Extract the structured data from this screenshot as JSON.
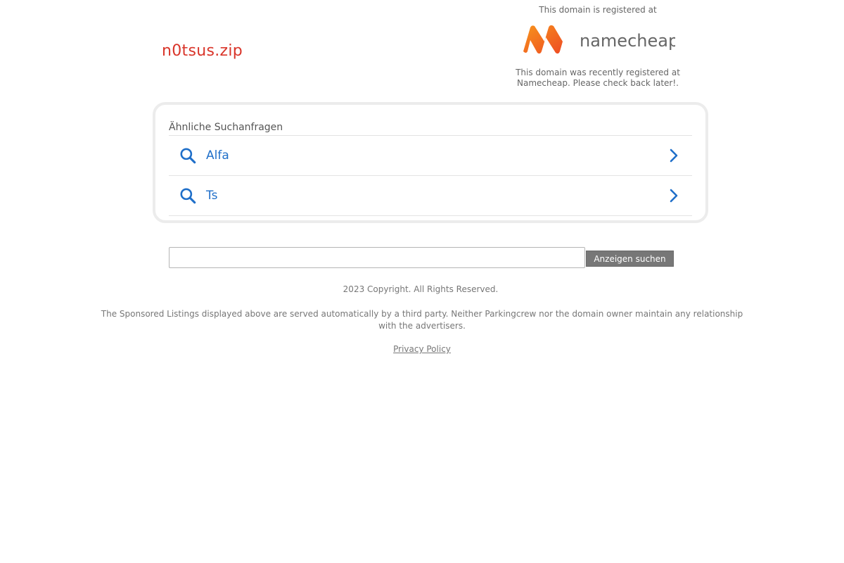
{
  "domain": {
    "name": "n0tsus.zip"
  },
  "registrar": {
    "top_text": "This domain is registered at",
    "logo_icon": "namecheap-logo",
    "logo_text": "namecheap",
    "bottom_text": "This domain was recently registered at Namecheap. Please check back later!."
  },
  "related": {
    "heading": "Ähnliche Suchanfragen",
    "items": [
      {
        "label": "Alfa",
        "icon": "search-icon",
        "arrow": "chevron-right-icon"
      },
      {
        "label": "Ts",
        "icon": "search-icon",
        "arrow": "chevron-right-icon"
      }
    ]
  },
  "search": {
    "value": "",
    "button_label": "Anzeigen suchen"
  },
  "footer": {
    "copyright": "2023 Copyright. All Rights Reserved.",
    "disclaimer": "The Sponsored Listings displayed above are served automatically by a third party. Neither Parkingcrew nor the domain owner maintain any relationship with the advertisers.",
    "privacy_label": "Privacy Policy"
  },
  "colors": {
    "domain_title": "#d9352a",
    "link_blue": "#1f6fc9",
    "logo_orange": "#f26522",
    "button_gray": "#777777"
  }
}
